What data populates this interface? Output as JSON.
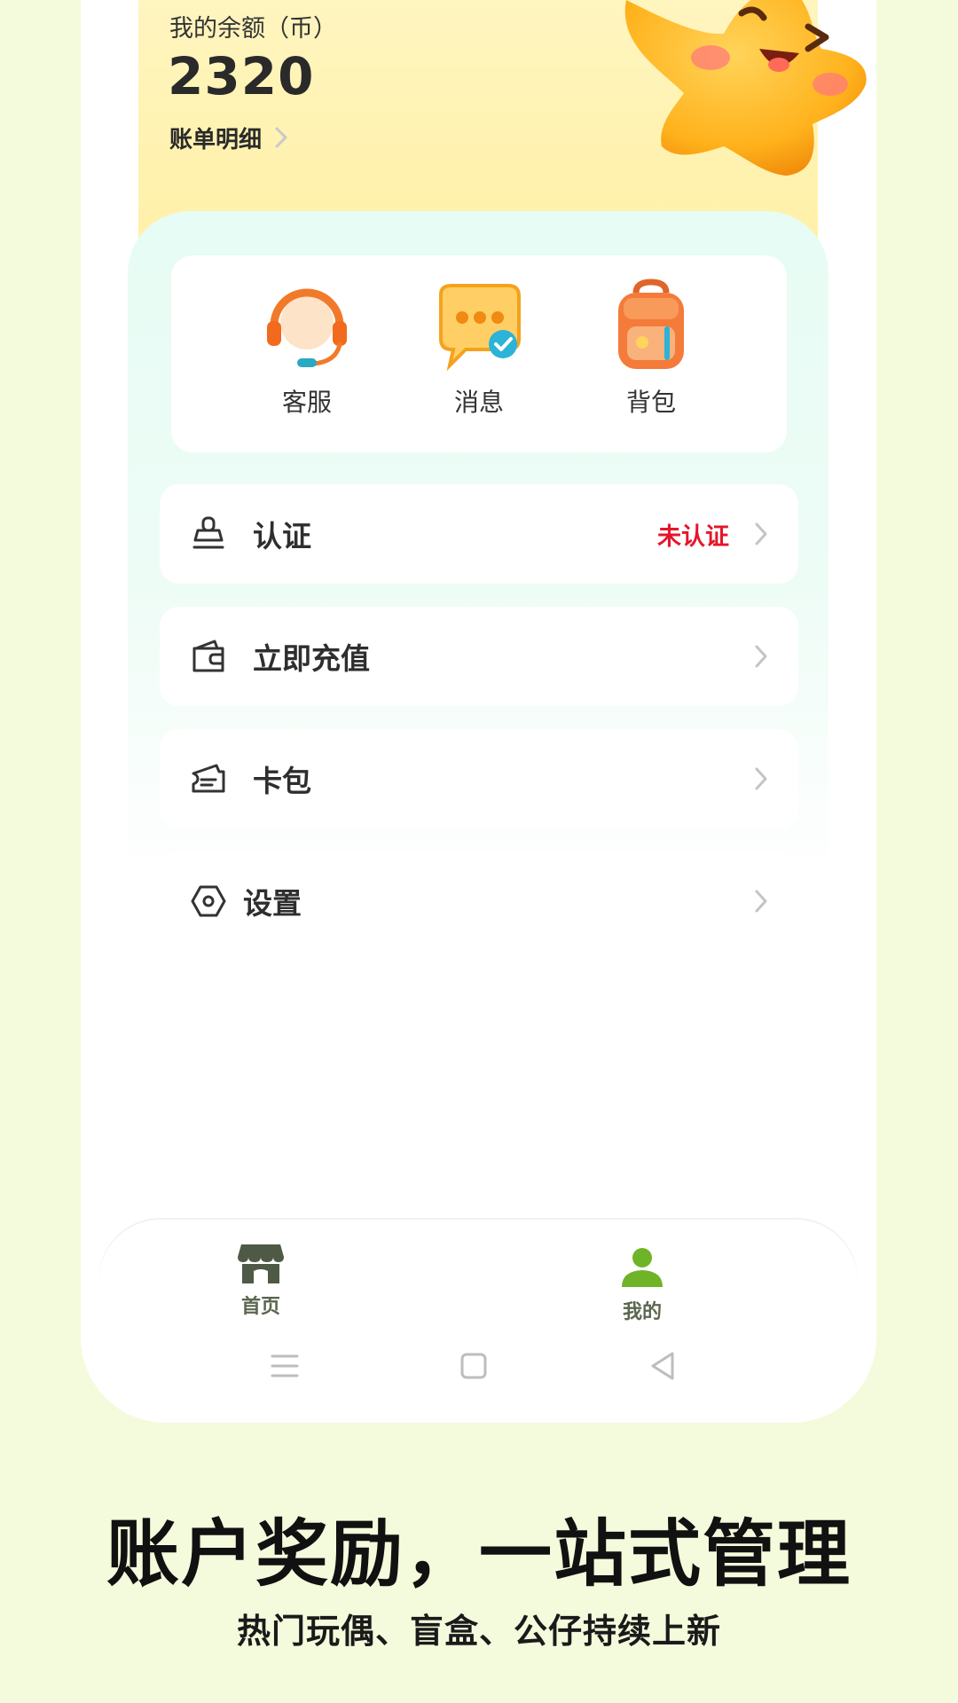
{
  "balance": {
    "label": "我的余额（币）",
    "value": "2320",
    "bill_link": "账单明细"
  },
  "quick_actions": [
    {
      "label": "客服",
      "icon": "headset-icon"
    },
    {
      "label": "消息",
      "icon": "chat-bubble-icon"
    },
    {
      "label": "背包",
      "icon": "backpack-icon"
    }
  ],
  "menu": [
    {
      "label": "认证",
      "icon": "stamp-icon",
      "status": "未认证"
    },
    {
      "label": "立即充值",
      "icon": "wallet-icon",
      "status": ""
    },
    {
      "label": "卡包",
      "icon": "ticket-icon",
      "status": ""
    },
    {
      "label": "设置",
      "icon": "hexagon-settings-icon",
      "status": ""
    }
  ],
  "tabbar": {
    "home": "首页",
    "mine": "我的"
  },
  "promo": {
    "headline": "账户奖励，一站式管理",
    "subline": "热门玩偶、盲盒、公仔持续上新"
  },
  "colors": {
    "background": "#f4fbdc",
    "status_red": "#e4162b",
    "tab_active": "#6fb327",
    "tab_inactive": "#4e5a45"
  }
}
